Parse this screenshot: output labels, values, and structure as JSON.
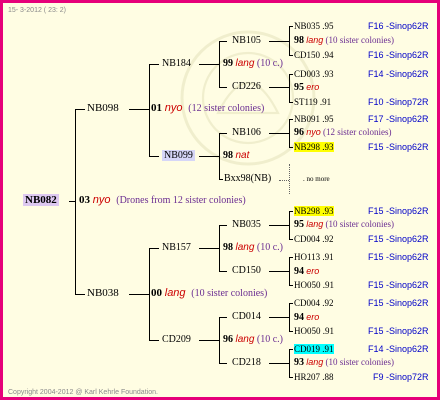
{
  "header_date": "15- 3-2012 ( 23: 2)",
  "footer": "Copyright 2004-2012 @ Karl Kehrle Foundation.",
  "root": {
    "name": "NB082",
    "gen": "03",
    "race": "nyo",
    "note": "(Drones from 12 sister colonies)"
  },
  "level1": [
    {
      "name": "NB098",
      "gen": "01",
      "race": "nyo",
      "note": "(12 sister colonies)"
    },
    {
      "name": "NB038",
      "gen": "00",
      "race": "lang",
      "note": "(10 sister colonies)"
    }
  ],
  "level2": [
    {
      "name": "NB184",
      "gen": "99",
      "race": "lang",
      "note": "(10 c.)"
    },
    {
      "name": "NB099",
      "gen": "98",
      "race": "nat"
    },
    {
      "name": "NB157",
      "gen": "98",
      "race": "lang",
      "note": "(10 c.)"
    },
    {
      "name": "CD209",
      "gen": "96",
      "race": "lang",
      "note": "(10 c.)"
    }
  ],
  "level3": [
    {
      "name": "NB105",
      "gen": "98",
      "race": "lang",
      "note": "(10 sister colonies)"
    },
    {
      "name": "CD226",
      "gen": "95",
      "race": "ero"
    },
    {
      "name": "NB106",
      "gen": "96",
      "race": "nyo",
      "note": "(12 sister colonies)"
    },
    {
      "name": "Bxx98(NB)",
      "extra": ". no more"
    },
    {
      "name": "CD150",
      "gen": "94",
      "race": "ero"
    },
    {
      "name": "NB035",
      "gen": "95",
      "race": "lang",
      "note": "(10 sister colonies)"
    },
    {
      "name": "CD014",
      "gen": "94",
      "race": "ero"
    },
    {
      "name": "CD218",
      "gen": "93",
      "race": "lang",
      "note": "(10 sister colonies)"
    }
  ],
  "leaves": [
    {
      "id": "NB035",
      "year": ".95",
      "loc": "F16 -Sinop62R"
    },
    {
      "id": "CD150",
      "year": ".94",
      "loc": "F16 -Sinop62R"
    },
    {
      "id": "CD003",
      "year": ".93",
      "loc": "F14 -Sinop62R"
    },
    {
      "id": "ST119",
      "year": ".91",
      "loc": "F10 -Sinop72R"
    },
    {
      "id": "NB091",
      "year": ".95",
      "loc": "F17 -Sinop62R"
    },
    {
      "id": "NB298",
      "year": ".93",
      "loc": "F15 -Sinop62R"
    },
    {
      "id": "NB298",
      "year": ".93",
      "loc": "F15 -Sinop62R"
    },
    {
      "id": "CD004",
      "year": ".92",
      "loc": "F15 -Sinop62R"
    },
    {
      "id": "HO113",
      "year": ".91",
      "loc": "F15 -Sinop62R"
    },
    {
      "id": "HO050",
      "year": ".91",
      "loc": "F15 -Sinop62R"
    },
    {
      "id": "CD004",
      "year": ".92",
      "loc": "F15 -Sinop62R"
    },
    {
      "id": "HO050",
      "year": ".91",
      "loc": "F15 -Sinop62R"
    },
    {
      "id": "CD019",
      "year": ".91",
      "loc": "F14 -Sinop62R"
    },
    {
      "id": "HR207",
      "year": ".88",
      "loc": "F9 -Sinop72R"
    }
  ]
}
